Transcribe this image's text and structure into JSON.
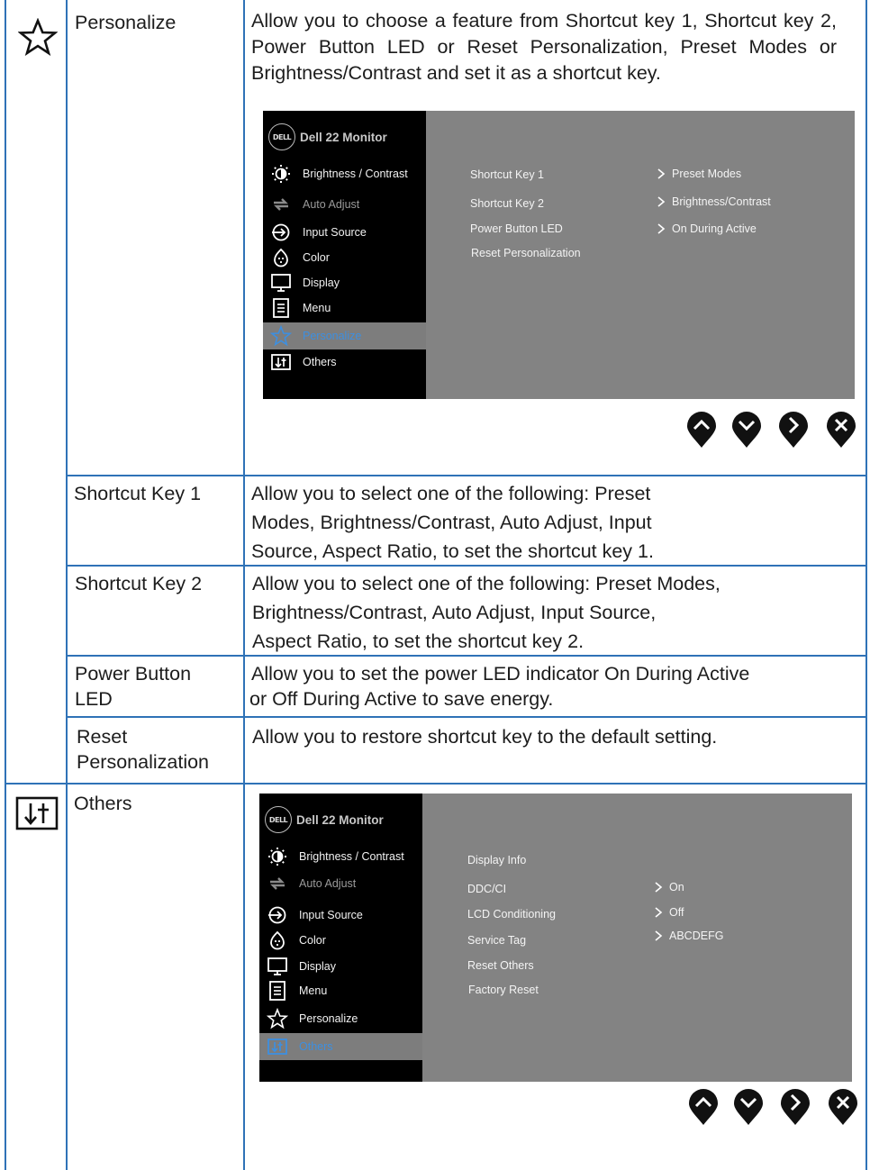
{
  "rows": {
    "personalize": {
      "name": "Personalize",
      "icon": "star-icon",
      "description": "Allow you to choose a feature from Shortcut key 1, Shortcut key 2, Power Button LED or Reset Personalization, Preset Modes or Brightness/Contrast and set it as a shortcut key."
    },
    "shortcut1": {
      "name": "Shortcut Key 1",
      "desc_lines": [
        "Allow you to select one of the following: Preset",
        "Modes, Brightness/Contrast, Auto Adjust, Input",
        "Source, Aspect Ratio, to set the shortcut key 1."
      ]
    },
    "shortcut2": {
      "name": "Shortcut Key 2",
      "desc_lines": [
        "Allow you to select one of the following: Preset Modes,",
        "Brightness/Contrast, Auto Adjust, Input Source,",
        "Aspect Ratio, to set the shortcut key 2."
      ]
    },
    "power_led": {
      "name_lines": [
        "Power Button",
        "LED"
      ],
      "desc_lines": [
        "Allow you to set the power LED indicator On During Active",
        "or Off During Active to save energy."
      ]
    },
    "reset": {
      "name_lines": [
        "Reset",
        "Personalization"
      ],
      "description": "Allow you to restore shortcut key to the default setting."
    },
    "others": {
      "name": "Others",
      "icon": "others-icon"
    }
  },
  "osd1": {
    "logo": "DELL",
    "title": "Dell 22 Monitor",
    "menu": [
      {
        "label": "Brightness / Contrast",
        "icon": "brightness-icon"
      },
      {
        "label": "Auto Adjust",
        "icon": "auto-adjust-icon"
      },
      {
        "label": "Input Source",
        "icon": "input-source-icon"
      },
      {
        "label": "Color",
        "icon": "color-icon"
      },
      {
        "label": "Display",
        "icon": "display-icon"
      },
      {
        "label": "Menu",
        "icon": "menu-icon"
      },
      {
        "label": "Personalize",
        "icon": "star-icon"
      },
      {
        "label": "Others",
        "icon": "others-icon"
      }
    ],
    "options": [
      "Shortcut Key 1",
      "Shortcut Key 2",
      "Power Button LED",
      "Reset Personalization"
    ],
    "values": [
      "Preset Modes",
      "Brightness/Contrast",
      "On During Active"
    ]
  },
  "osd2": {
    "logo": "DELL",
    "title": "Dell 22 Monitor",
    "menu": [
      {
        "label": "Brightness / Contrast",
        "icon": "brightness-icon"
      },
      {
        "label": "Auto Adjust",
        "icon": "auto-adjust-icon"
      },
      {
        "label": "Input Source",
        "icon": "input-source-icon"
      },
      {
        "label": "Color",
        "icon": "color-icon"
      },
      {
        "label": "Display",
        "icon": "display-icon"
      },
      {
        "label": "Menu",
        "icon": "menu-icon"
      },
      {
        "label": "Personalize",
        "icon": "star-icon"
      },
      {
        "label": "Others",
        "icon": "others-icon"
      }
    ],
    "options": [
      "Display Info",
      "DDC/CI",
      "LCD Conditioning",
      "Service Tag",
      "Reset Others",
      "Factory Reset"
    ],
    "values": [
      "On",
      "Off",
      "ABCDEFG"
    ]
  },
  "nav_buttons": [
    "up-button",
    "down-button",
    "next-button",
    "exit-button"
  ],
  "colors": {
    "border": "#2f72b7",
    "osd_bg": "#838383",
    "osd_menu": "#000000",
    "highlight": "#3d8fe0"
  }
}
